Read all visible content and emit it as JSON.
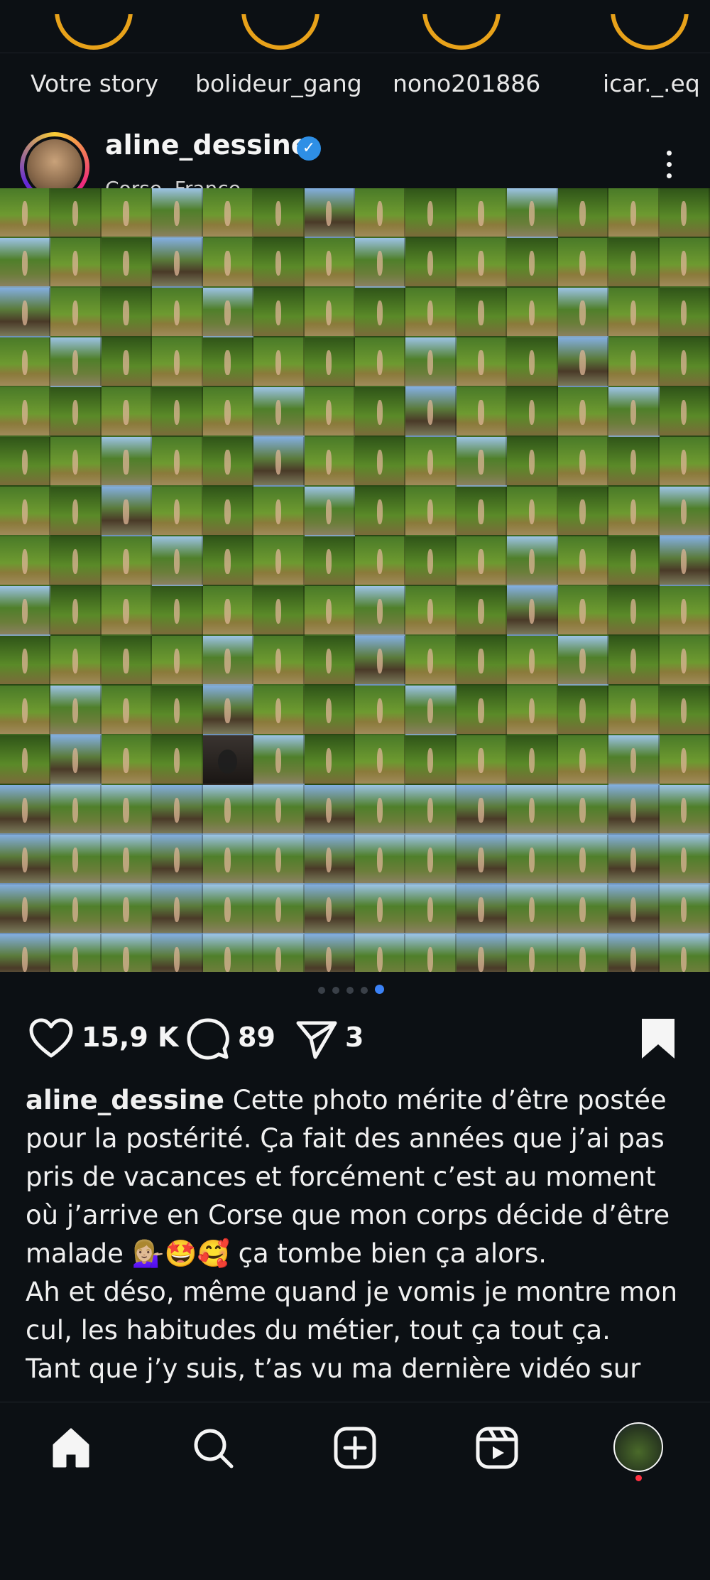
{
  "stories": [
    {
      "label": "Votre story"
    },
    {
      "label": "bolideur_gang"
    },
    {
      "label": "nono201886"
    },
    {
      "label": "icar._.eq"
    }
  ],
  "post": {
    "username": "aline_dessine",
    "location": "Corse, France",
    "carousel": {
      "count": 5,
      "active_index": 4
    },
    "likes": "15,9 K",
    "comments": "89",
    "shares": "3",
    "caption_username": "aline_dessine",
    "caption_text": "Cette photo mérite d’être postée pour la postérité. Ça fait des années que j’ai pas pris de vacances et forcément c’est au moment où j’arrive en Corse que mon corps décide d’être malade 💁🏼‍♀️🤩🥰 ça tombe bien ça alors.",
    "caption_more": "Ah et déso, même quand je vomis je montre mon cul, les habitudes du métier, tout ça tout ça.",
    "caption_more2": "Tant que j’y suis, t’as vu ma dernière vidéo sur"
  },
  "icons": {
    "like": "heart-icon",
    "comment": "comment-icon",
    "share": "share-icon",
    "save": "bookmark-icon",
    "more": "more-icon",
    "nav": [
      "home-icon",
      "search-icon",
      "create-icon",
      "reels-icon",
      "profile-icon"
    ]
  },
  "colors": {
    "background": "#0c1014",
    "story_ring": "#e8a21a",
    "verified": "#2e8fe6",
    "active_dot": "#3b82f6",
    "notification": "#ff3040"
  }
}
